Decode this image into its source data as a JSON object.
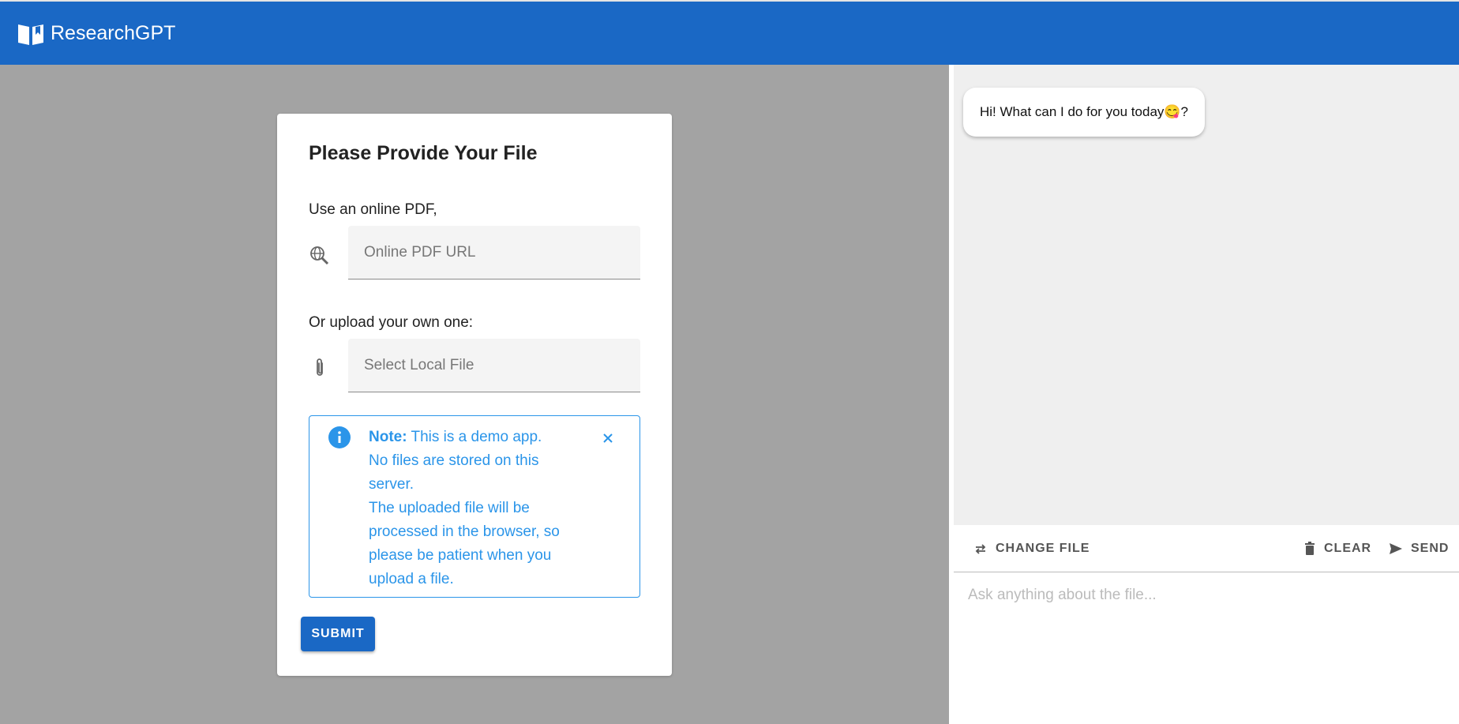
{
  "appbar": {
    "title": "ResearchGPT",
    "icon": "book-icon",
    "color": "#1a68c5"
  },
  "form": {
    "title": "Please Provide Your File",
    "online_label": "Use an online PDF,",
    "online_placeholder": "Online PDF URL",
    "online_icon": "globe-search-icon",
    "upload_label": "Or upload your own one:",
    "upload_placeholder": "Select Local File",
    "upload_icon": "paperclip-icon",
    "note": {
      "bold": "Note:",
      "line1": " This is a demo app.",
      "line2": "No files are stored on this server.",
      "line3": "The uploaded file will be processed in the browser, so please be patient when you upload a file.",
      "color": "#2b95e9"
    },
    "submit_label": "SUBMIT"
  },
  "chat": {
    "greeting": "Hi! What can I do for you today😋?",
    "change_file_label": "CHANGE FILE",
    "clear_label": "CLEAR",
    "send_label": "SEND",
    "input_placeholder": "Ask anything about the file..."
  }
}
